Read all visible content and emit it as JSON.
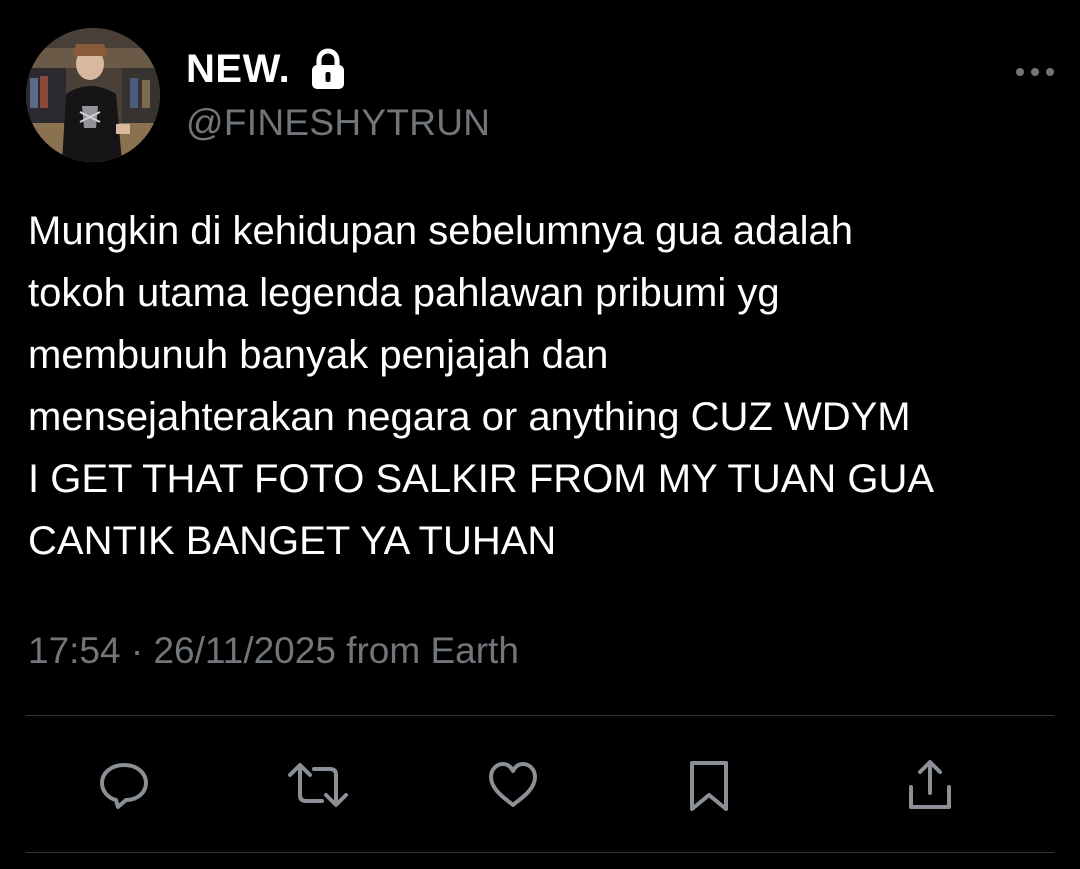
{
  "tweet": {
    "author": {
      "display_name": "NEW.",
      "handle": "@FINESHYTRUN",
      "protected_icon": "lock-icon",
      "avatar": "profile-photo"
    },
    "more_icon": "more-horizontal-icon",
    "text_lines": [
      "Mungkin di kehidupan sebelumnya gua adalah",
      "tokoh utama legenda pahlawan pribumi yg",
      "membunuh banyak penjajah dan",
      "mensejahterakan negara or anything CUZ WDYM",
      "I GET THAT FOTO SALKIR FROM MY TUAN GUA",
      "CANTIK BANGET YA TUHAN"
    ],
    "time": "17:54",
    "separator": "·",
    "date": "26/11/2025",
    "source": "from Earth"
  },
  "actions": [
    {
      "name": "reply",
      "icon": "reply-icon"
    },
    {
      "name": "retweet",
      "icon": "retweet-icon"
    },
    {
      "name": "like",
      "icon": "heart-icon"
    },
    {
      "name": "bookmark",
      "icon": "bookmark-icon"
    },
    {
      "name": "share",
      "icon": "share-icon"
    }
  ],
  "colors": {
    "background": "#000000",
    "text_primary": "#ffffff",
    "text_secondary": "#71767b",
    "divider": "#2f3336"
  }
}
